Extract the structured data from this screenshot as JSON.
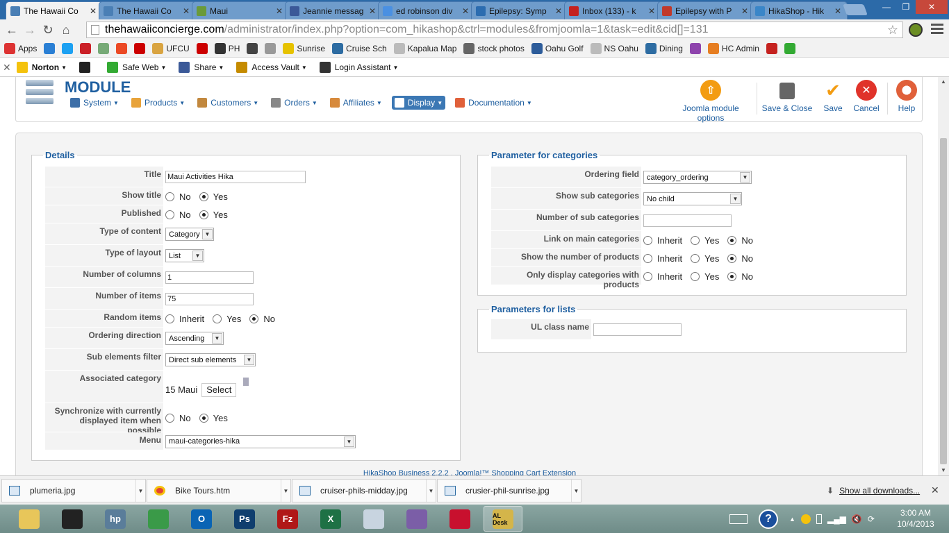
{
  "browser": {
    "tabs": [
      {
        "label": "The Hawaii Co",
        "favicon": "hikashop-icon",
        "color": "#4a7fb5",
        "active": true
      },
      {
        "label": "The Hawaii Co",
        "favicon": "hikashop-icon",
        "color": "#4a7fb5"
      },
      {
        "label": "Maui",
        "favicon": "leaf-icon",
        "color": "#6a9a3a"
      },
      {
        "label": "Jeannie messag",
        "favicon": "facebook-icon",
        "color": "#3b5998"
      },
      {
        "label": "ed robinson div",
        "favicon": "google-icon",
        "color": "#4a90e2"
      },
      {
        "label": "Epilepsy: Symp",
        "favicon": "webmd-icon",
        "color": "#2b6cb0"
      },
      {
        "label": "Inbox (133) - k",
        "favicon": "gmail-icon",
        "color": "#c5221f"
      },
      {
        "label": "Epilepsy with P",
        "favicon": "apple-icon",
        "color": "#c0392b"
      },
      {
        "label": "HikaShop - Hik",
        "favicon": "hikashop-icon",
        "color": "#3a86c8"
      }
    ],
    "url_host": "thehawaiiconcierge.com",
    "url_path": "/administrator/index.php?option=com_hikashop&ctrl=modules&fromjoomla=1&task=edit&cid[]=131",
    "bookmarks": [
      {
        "label": "Apps",
        "icon": "apps-grid-icon",
        "color": "#d33"
      },
      {
        "label": "",
        "icon": "hawaii-icon",
        "color": "#2a7fd4"
      },
      {
        "label": "",
        "icon": "twitter-icon",
        "color": "#1da1f2"
      },
      {
        "label": "",
        "icon": "pinterest-icon",
        "color": "#cb2027"
      },
      {
        "label": "",
        "icon": "photo-icon",
        "color": "#7a7"
      },
      {
        "label": "",
        "icon": "stumble-icon",
        "color": "#eb4924"
      },
      {
        "label": "",
        "icon": "lastpass-icon",
        "color": "#c00"
      },
      {
        "label": "UFCU",
        "icon": "diamond-icon",
        "color": "#d9a441"
      },
      {
        "label": "",
        "icon": "xf-icon",
        "color": "#c00"
      },
      {
        "label": "PH",
        "icon": "ph-icon",
        "color": "#333"
      },
      {
        "label": "",
        "icon": "eye-icon",
        "color": "#444"
      },
      {
        "label": "",
        "icon": "flag-icon",
        "color": "#999"
      },
      {
        "label": "Sunrise",
        "icon": "smiley-icon",
        "color": "#e6c200"
      },
      {
        "label": "Cruise Sch",
        "icon": "globe-icon",
        "color": "#2d6ca2"
      },
      {
        "label": "Kapalua Map",
        "icon": "page-icon",
        "color": "#bbb"
      },
      {
        "label": "stock photos",
        "icon": "camera-icon",
        "color": "#666"
      },
      {
        "label": "Oahu Golf",
        "icon": "golf-icon",
        "color": "#2d5c9a"
      },
      {
        "label": "NS Oahu",
        "icon": "page-icon",
        "color": "#bbb"
      },
      {
        "label": "Dining",
        "icon": "dining-icon",
        "color": "#2d6ca2"
      },
      {
        "label": "",
        "icon": "circle-icon",
        "color": "#8e44ad"
      },
      {
        "label": "HC Admin",
        "icon": "joomla-icon",
        "color": "#e67e22"
      },
      {
        "label": "",
        "icon": "gmail-icon",
        "color": "#c5221f"
      },
      {
        "label": "",
        "icon": "ns-icon",
        "color": "#3a3"
      }
    ],
    "norton": [
      {
        "label": "Norton",
        "icon": "norton-check-icon",
        "color": "#f4c20d",
        "caret": true
      },
      {
        "label": "",
        "icon": "home-icon",
        "color": "#222",
        "caret": false
      },
      {
        "label": "Safe Web",
        "icon": "ok-icon",
        "color": "#3a3",
        "caret": true
      },
      {
        "label": "Share",
        "icon": "facebook-icon",
        "color": "#3b5998",
        "caret": true
      },
      {
        "label": "Access Vault",
        "icon": "vault-icon",
        "color": "#c58b00",
        "caret": true
      },
      {
        "label": "Login Assistant",
        "icon": "login-icon",
        "color": "#333",
        "caret": true
      }
    ]
  },
  "joomla": {
    "title": "MODULE",
    "menu": [
      {
        "label": "System",
        "icon": "wrench-icon",
        "color": "#3d6fa8"
      },
      {
        "label": "Products",
        "icon": "box-icon",
        "color": "#e8a33a"
      },
      {
        "label": "Customers",
        "icon": "user-icon",
        "color": "#c2883e"
      },
      {
        "label": "Orders",
        "icon": "orders-icon",
        "color": "#888"
      },
      {
        "label": "Affiliates",
        "icon": "affiliate-icon",
        "color": "#d78a3c"
      },
      {
        "label": "Display",
        "icon": "display-icon",
        "color": "#fff",
        "active": true
      },
      {
        "label": "Documentation",
        "icon": "lifebuoy-icon",
        "color": "#e0603a"
      }
    ],
    "toolbar": {
      "options": "Joomla module options",
      "save_close": "Save & Close",
      "save": "Save",
      "cancel": "Cancel",
      "help": "Help"
    }
  },
  "details": {
    "legend": "Details",
    "title_label": "Title",
    "title_value": "Maui Activities Hika",
    "show_title_label": "Show title",
    "published_label": "Published",
    "type_content_label": "Type of content",
    "type_content_value": "Category",
    "type_layout_label": "Type of layout",
    "type_layout_value": "List",
    "num_columns_label": "Number of columns",
    "num_columns_value": "1",
    "num_items_label": "Number of items",
    "num_items_value": "75",
    "random_label": "Random items",
    "ordering_dir_label": "Ordering direction",
    "ordering_dir_value": "Ascending",
    "sub_filter_label": "Sub elements filter",
    "sub_filter_value": "Direct sub elements",
    "assoc_label": "Associated category",
    "assoc_value": "15 Maui",
    "select_btn": "Select",
    "sync_label_1": "Synchronize with currently",
    "sync_label_2": "displayed item when possible",
    "menu_label": "Menu",
    "menu_value": "maui-categories-hika",
    "opt_no": "No",
    "opt_yes": "Yes",
    "opt_inherit": "Inherit"
  },
  "categories": {
    "legend": "Parameter for categories",
    "ordering_label": "Ordering field",
    "ordering_value": "category_ordering",
    "show_sub_label": "Show sub categories",
    "show_sub_value": "No child",
    "num_sub_label": "Number of sub categories",
    "num_sub_value": "",
    "link_main_label": "Link on main categories",
    "show_num_label": "Show the number of products",
    "only_display_label": "Only display categories with products"
  },
  "lists": {
    "legend": "Parameters for lists",
    "ul_label": "UL class name",
    "ul_value": ""
  },
  "footer": "HikaShop Business 2.2.2 , Joomla!™ Shopping Cart Extension",
  "downloads": {
    "items": [
      "plumeria.jpg",
      "Bike Tours.htm",
      "cruiser-phils-midday.jpg",
      "crusier-phil-sunrise.jpg"
    ],
    "show_all": "Show all downloads..."
  },
  "taskbar": {
    "apps": [
      {
        "icon": "explorer-icon",
        "color": "#e8c65a",
        "label": ""
      },
      {
        "icon": "media-player-icon",
        "color": "#222",
        "label": ""
      },
      {
        "icon": "hp-icon",
        "color": "#5a7d9a",
        "label": "hp"
      },
      {
        "icon": "chrome-icon",
        "color": "#3a9a48",
        "label": ""
      },
      {
        "icon": "outlook-icon",
        "color": "#0a64b4",
        "label": "O"
      },
      {
        "icon": "photoshop-icon",
        "color": "#0f3e6e",
        "label": "Ps"
      },
      {
        "icon": "filezilla-icon",
        "color": "#b01818",
        "label": "Fz"
      },
      {
        "icon": "excel-icon",
        "color": "#1e7145",
        "label": "X"
      },
      {
        "icon": "reader-icon",
        "color": "#c8d4e0",
        "label": ""
      },
      {
        "icon": "pidgin-icon",
        "color": "#7b5ea7",
        "label": ""
      },
      {
        "icon": "acrobat-icon",
        "color": "#c8102e",
        "label": ""
      },
      {
        "icon": "desk-icon",
        "color": "#d4b54a",
        "label": "AL Desk"
      }
    ],
    "time": "3:00 AM",
    "date": "10/4/2013"
  }
}
